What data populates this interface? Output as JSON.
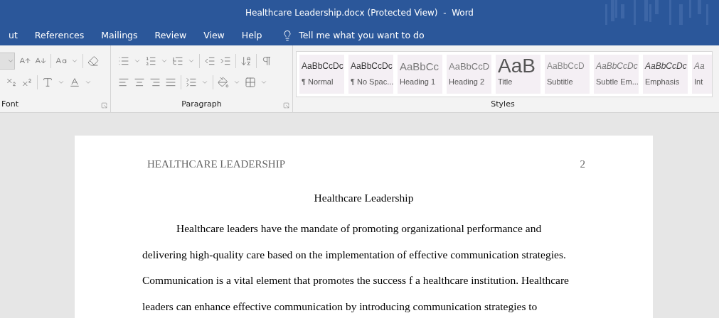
{
  "window": {
    "title": "Healthcare Leadership.docx (Protected View)  -  Word"
  },
  "tabs": [
    {
      "label": "ut",
      "selected": false
    },
    {
      "label": "References",
      "selected": false
    },
    {
      "label": "Mailings",
      "selected": false
    },
    {
      "label": "Review",
      "selected": false
    },
    {
      "label": "View",
      "selected": false
    },
    {
      "label": "Help",
      "selected": false
    }
  ],
  "tell_me": {
    "placeholder": "Tell me what you want to do"
  },
  "ribbon": {
    "groups": [
      {
        "label": "Font"
      },
      {
        "label": "Paragraph"
      },
      {
        "label": "Styles"
      }
    ],
    "styles": [
      {
        "preview": "AaBbCcDc",
        "label": "¶ Normal",
        "kind": "normal"
      },
      {
        "preview": "AaBbCcDc",
        "label": "¶ No Spac...",
        "kind": "normal"
      },
      {
        "preview": "AaBbCc",
        "label": "Heading 1",
        "kind": "heading1"
      },
      {
        "preview": "AaBbCcD",
        "label": "Heading 2",
        "kind": "heading2"
      },
      {
        "preview": "AaB",
        "label": "Title",
        "kind": "title"
      },
      {
        "preview": "AaBbCcD",
        "label": "Subtitle",
        "kind": "subtitle"
      },
      {
        "preview": "AaBbCcDc",
        "label": "Subtle Em...",
        "kind": "subtle"
      },
      {
        "preview": "AaBbCcDc",
        "label": "Emphasis",
        "kind": "emphasis"
      },
      {
        "preview": "Aa",
        "label": "Int",
        "kind": "subtle"
      }
    ]
  },
  "document": {
    "header": {
      "running_head": "HEALTHCARE LEADERSHIP",
      "page_number": "2"
    },
    "title": "Healthcare Leadership",
    "paragraph": {
      "lines": [
        "Healthcare leaders have the mandate of promoting organizational performance and",
        "delivering high-quality care based on the implementation of effective communication strategies.",
        "Communication is a vital element that promotes the success f a healthcare institution. Healthcare",
        "leaders can enhance effective communication by introducing communication strategies to"
      ]
    }
  }
}
